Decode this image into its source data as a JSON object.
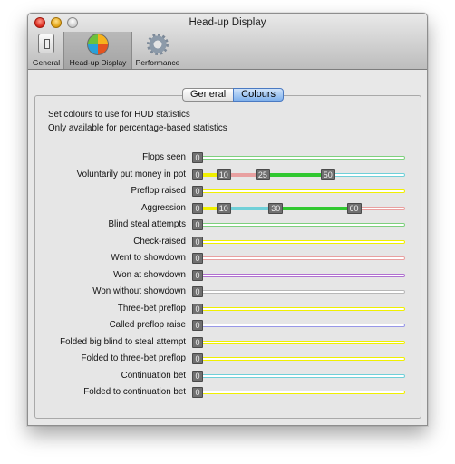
{
  "window": {
    "title": "Head-up Display"
  },
  "toolbar": [
    {
      "label": "General",
      "icon": "switch-icon"
    },
    {
      "label": "Head-up Display",
      "icon": "color-ball-icon"
    },
    {
      "label": "Performance",
      "icon": "gear-icon"
    }
  ],
  "tabs": [
    {
      "label": "General",
      "active": false
    },
    {
      "label": "Colours",
      "active": true
    }
  ],
  "description": {
    "line1": "Set colours to use for HUD statistics",
    "line2": "Only available for percentage-based statistics"
  },
  "colors": {
    "green": "#7ed07e",
    "yellow": "#f0f000",
    "pink": "#e8a0a0",
    "cyan": "#70d0d8",
    "purple": "#b070d0",
    "gray": "#b8b8b8",
    "lavender": "#9898e8",
    "bright_green": "#30c830"
  },
  "stats": [
    {
      "label": "Flops seen",
      "color": "green",
      "segments": [],
      "knobs": [
        "0"
      ]
    },
    {
      "label": "Voluntarily put money in pot",
      "color": "cyan",
      "segments": [
        {
          "from": 0,
          "to": 10,
          "color": "yellow"
        },
        {
          "from": 10,
          "to": 25,
          "color": "pink"
        },
        {
          "from": 25,
          "to": 50,
          "color": "bright_green"
        }
      ],
      "knobs": [
        "0",
        "10",
        "25",
        "50"
      ]
    },
    {
      "label": "Preflop raised",
      "color": "yellow",
      "segments": [],
      "knobs": [
        "0"
      ]
    },
    {
      "label": "Aggression",
      "color": "pink",
      "segments": [
        {
          "from": 0,
          "to": 10,
          "color": "yellow"
        },
        {
          "from": 10,
          "to": 30,
          "color": "cyan"
        },
        {
          "from": 30,
          "to": 60,
          "color": "bright_green"
        }
      ],
      "knobs": [
        "0",
        "10",
        "30",
        "60"
      ]
    },
    {
      "label": "Blind steal attempts",
      "color": "green",
      "segments": [],
      "knobs": [
        "0"
      ]
    },
    {
      "label": "Check-raised",
      "color": "yellow",
      "segments": [],
      "knobs": [
        "0"
      ]
    },
    {
      "label": "Went to showdown",
      "color": "pink",
      "segments": [],
      "knobs": [
        "0"
      ]
    },
    {
      "label": "Won at showdown",
      "color": "purple",
      "segments": [],
      "knobs": [
        "0"
      ]
    },
    {
      "label": "Won without showdown",
      "color": "gray",
      "segments": [],
      "knobs": [
        "0"
      ]
    },
    {
      "label": "Three-bet preflop",
      "color": "yellow",
      "segments": [],
      "knobs": [
        "0"
      ]
    },
    {
      "label": "Called preflop raise",
      "color": "lavender",
      "segments": [],
      "knobs": [
        "0"
      ]
    },
    {
      "label": "Folded big blind to steal attempt",
      "color": "yellow",
      "segments": [],
      "knobs": [
        "0"
      ]
    },
    {
      "label": "Folded to three-bet preflop",
      "color": "yellow",
      "segments": [],
      "knobs": [
        "0"
      ]
    },
    {
      "label": "Continuation bet",
      "color": "cyan",
      "segments": [],
      "knobs": [
        "0"
      ]
    },
    {
      "label": "Folded to continuation bet",
      "color": "yellow",
      "segments": [],
      "knobs": [
        "0"
      ]
    }
  ]
}
